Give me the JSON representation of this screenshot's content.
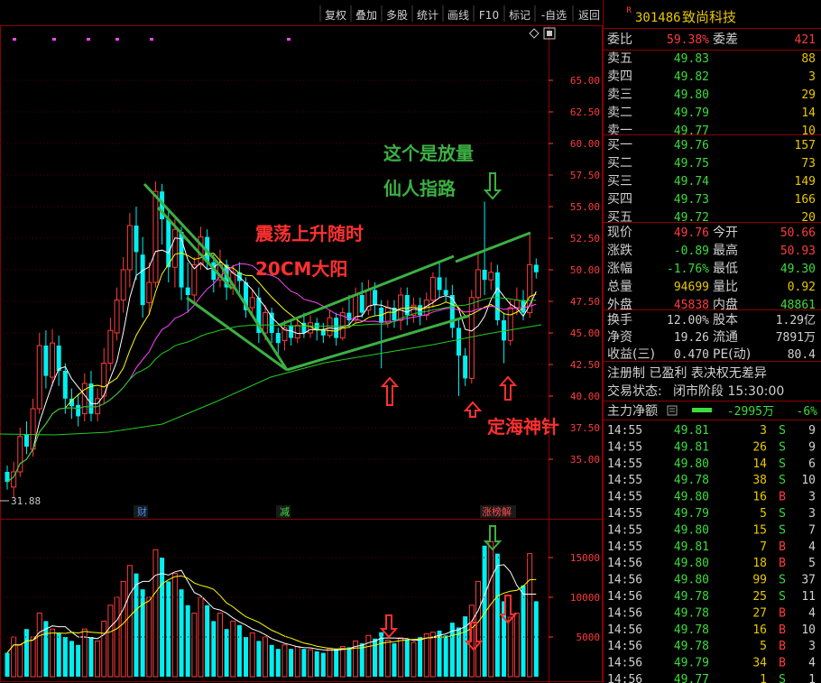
{
  "toolbar": {
    "buttons": [
      "复权",
      "叠加",
      "多股",
      "统计",
      "画线",
      "F10",
      "标记",
      "-自选",
      "返回"
    ]
  },
  "stock": {
    "badge": "R",
    "code": "301486",
    "name": "致尚科技"
  },
  "order_ratio": {
    "label1": "委比",
    "value1": "59.38%",
    "label2": "委差",
    "value2": "421"
  },
  "asks": [
    {
      "label": "卖五",
      "price": "49.83",
      "vol": "88"
    },
    {
      "label": "卖四",
      "price": "49.82",
      "vol": "3"
    },
    {
      "label": "卖三",
      "price": "49.80",
      "vol": "29"
    },
    {
      "label": "卖二",
      "price": "49.79",
      "vol": "14"
    },
    {
      "label": "卖一",
      "price": "49.77",
      "vol": "10"
    }
  ],
  "bids": [
    {
      "label": "买一",
      "price": "49.76",
      "vol": "157"
    },
    {
      "label": "买二",
      "price": "49.75",
      "vol": "73"
    },
    {
      "label": "买三",
      "price": "49.74",
      "vol": "149"
    },
    {
      "label": "买四",
      "price": "49.73",
      "vol": "166"
    },
    {
      "label": "买五",
      "price": "49.72",
      "vol": "20"
    }
  ],
  "quote": [
    {
      "l1": "现价",
      "v1": "49.76",
      "c1": "#ff3c3c",
      "l2": "今开",
      "v2": "50.66",
      "c2": "#ff3c3c"
    },
    {
      "l1": "涨跌",
      "v1": "-0.89",
      "c1": "#3cdc3c",
      "l2": "最高",
      "v2": "50.93",
      "c2": "#ff3c3c"
    },
    {
      "l1": "涨幅",
      "v1": "-1.76%",
      "c1": "#3cdc3c",
      "l2": "最低",
      "v2": "49.30",
      "c2": "#3cdc3c"
    },
    {
      "l1": "总量",
      "v1": "94699",
      "c1": "#e8c800",
      "l2": "量比",
      "v2": "0.92",
      "c2": "#e8c800"
    },
    {
      "l1": "外盘",
      "v1": "45838",
      "c1": "#ff3c3c",
      "l2": "内盘",
      "v2": "48861",
      "c2": "#3cdc3c"
    }
  ],
  "stats": [
    {
      "l1": "换手",
      "v1": "12.00%",
      "l2": "股本",
      "v2": "1.29亿"
    },
    {
      "l1": "净资",
      "v1": "19.26",
      "l2": "流通",
      "v2": "7891万"
    },
    {
      "l1": "收益(三)",
      "v1": "0.470",
      "l2": "PE(动)",
      "v2": "80.4"
    }
  ],
  "notes": {
    "reg": "注册制 已盈利 表决权无差异",
    "status_label": "交易状态:",
    "status_value": "闭市阶段 15:30:00"
  },
  "main_flow": {
    "label": "主力净额",
    "value": "-2995万",
    "pct": "-6%"
  },
  "ticks": [
    [
      "14:55",
      "49.81",
      "3",
      "S",
      "9"
    ],
    [
      "14:55",
      "49.81",
      "26",
      "S",
      "9"
    ],
    [
      "14:55",
      "49.80",
      "14",
      "S",
      "6"
    ],
    [
      "14:55",
      "49.78",
      "38",
      "S",
      "10"
    ],
    [
      "14:55",
      "49.80",
      "16",
      "B",
      "3"
    ],
    [
      "14:55",
      "49.79",
      "5",
      "S",
      "3"
    ],
    [
      "14:55",
      "49.80",
      "15",
      "S",
      "7"
    ],
    [
      "14:55",
      "49.81",
      "7",
      "B",
      "4"
    ],
    [
      "14:56",
      "49.80",
      "18",
      "B",
      "5"
    ],
    [
      "14:56",
      "49.80",
      "99",
      "S",
      "37"
    ],
    [
      "14:56",
      "49.78",
      "25",
      "S",
      "11"
    ],
    [
      "14:56",
      "49.78",
      "27",
      "B",
      "4"
    ],
    [
      "14:56",
      "49.78",
      "16",
      "B",
      "10"
    ],
    [
      "14:56",
      "49.78",
      "5",
      "B",
      "3"
    ],
    [
      "14:56",
      "49.79",
      "34",
      "B",
      "4"
    ],
    [
      "14:56",
      "49.77",
      "1",
      "S",
      "1"
    ]
  ],
  "annotations": {
    "left_title_1": "震荡上升随时",
    "left_title_2": "20CM大阳",
    "right_title_1": "这个是放量",
    "right_title_2": "仙人指路",
    "pin_label": "定海神针",
    "low_value": "31.88"
  },
  "event_markers": [
    "财",
    "减",
    "涨榜解"
  ],
  "chart_data": {
    "type": "candlestick",
    "y_range_price": [
      33.0,
      66.5
    ],
    "price_ticks": [
      "65.00",
      "62.50",
      "60.00",
      "57.50",
      "55.00",
      "52.50",
      "50.00",
      "47.50",
      "45.00",
      "42.50",
      "40.00",
      "37.50",
      "35.00"
    ],
    "volume_ticks": [
      "15000",
      "10000",
      "5000"
    ],
    "volume_range": [
      0,
      17500
    ],
    "candles": [
      {
        "o": 34,
        "c": 33.2,
        "h": 34.5,
        "l": 32.6
      },
      {
        "o": 32.8,
        "c": 34,
        "h": 34.8,
        "l": 31.9
      },
      {
        "o": 34,
        "c": 36.8,
        "h": 37.5,
        "l": 33.6
      },
      {
        "o": 37,
        "c": 36,
        "h": 38,
        "l": 35.4
      },
      {
        "o": 35.8,
        "c": 39,
        "h": 39.8,
        "l": 35.2
      },
      {
        "o": 39,
        "c": 44,
        "h": 45,
        "l": 38.6
      },
      {
        "o": 44,
        "c": 41.6,
        "h": 45.2,
        "l": 40.6
      },
      {
        "o": 41.5,
        "c": 44.2,
        "h": 45.3,
        "l": 40.8
      },
      {
        "o": 44,
        "c": 42,
        "h": 44.8,
        "l": 40.8
      },
      {
        "o": 42,
        "c": 39.8,
        "h": 42.6,
        "l": 38.6
      },
      {
        "o": 39.8,
        "c": 39.2,
        "h": 40.6,
        "l": 38.2
      },
      {
        "o": 39.3,
        "c": 38.4,
        "h": 40.2,
        "l": 37.6
      },
      {
        "o": 38.6,
        "c": 41,
        "h": 41.8,
        "l": 38
      },
      {
        "o": 41,
        "c": 38.6,
        "h": 42,
        "l": 38
      },
      {
        "o": 38.6,
        "c": 39.8,
        "h": 40.6,
        "l": 38
      },
      {
        "o": 40,
        "c": 42.6,
        "h": 43.8,
        "l": 39.4
      },
      {
        "o": 42.6,
        "c": 45.2,
        "h": 46.2,
        "l": 42
      },
      {
        "o": 45,
        "c": 47.6,
        "h": 48.6,
        "l": 44.4
      },
      {
        "o": 47.6,
        "c": 50,
        "h": 51,
        "l": 46.6
      },
      {
        "o": 50,
        "c": 53.5,
        "h": 54.5,
        "l": 48.6
      },
      {
        "o": 53.5,
        "c": 51.4,
        "h": 55,
        "l": 49.2
      },
      {
        "o": 51.2,
        "c": 47.2,
        "h": 52.6,
        "l": 46.2
      },
      {
        "o": 47.4,
        "c": 49,
        "h": 50.6,
        "l": 46.4
      },
      {
        "o": 49,
        "c": 56.2,
        "h": 57,
        "l": 48.6
      },
      {
        "o": 56.2,
        "c": 54,
        "h": 56.8,
        "l": 52
      },
      {
        "o": 54,
        "c": 50.2,
        "h": 54.8,
        "l": 49
      },
      {
        "o": 50.2,
        "c": 53.2,
        "h": 54,
        "l": 48.6
      },
      {
        "o": 53,
        "c": 48.6,
        "h": 53.4,
        "l": 47.6
      },
      {
        "o": 48.6,
        "c": 48,
        "h": 50.6,
        "l": 46.6
      },
      {
        "o": 48,
        "c": 50.4,
        "h": 51,
        "l": 47.2
      },
      {
        "o": 50.4,
        "c": 52.6,
        "h": 53.4,
        "l": 50
      },
      {
        "o": 52.6,
        "c": 50.6,
        "h": 53.2,
        "l": 50
      },
      {
        "o": 50.6,
        "c": 49.2,
        "h": 51.2,
        "l": 48.2
      },
      {
        "o": 49.2,
        "c": 50.4,
        "h": 51.6,
        "l": 48.6
      },
      {
        "o": 50.4,
        "c": 48.6,
        "h": 50.8,
        "l": 47.6
      },
      {
        "o": 48.6,
        "c": 49.8,
        "h": 50.4,
        "l": 48
      },
      {
        "o": 49.8,
        "c": 49.1,
        "h": 50.6,
        "l": 48.2
      },
      {
        "o": 49,
        "c": 46.8,
        "h": 49.4,
        "l": 46.2
      },
      {
        "o": 47,
        "c": 47.8,
        "h": 48.4,
        "l": 46.2
      },
      {
        "o": 47.8,
        "c": 45,
        "h": 48.6,
        "l": 44.2
      },
      {
        "o": 45,
        "c": 46.6,
        "h": 47.2,
        "l": 44.4
      },
      {
        "o": 46.6,
        "c": 45,
        "h": 47,
        "l": 44.2
      },
      {
        "o": 45,
        "c": 44.2,
        "h": 45.4,
        "l": 43.2
      },
      {
        "o": 44.4,
        "c": 45.4,
        "h": 46,
        "l": 43.6
      },
      {
        "o": 45.6,
        "c": 44.6,
        "h": 46,
        "l": 44
      },
      {
        "o": 44.6,
        "c": 45.6,
        "h": 46.2,
        "l": 44.2
      },
      {
        "o": 45.8,
        "c": 45,
        "h": 46.6,
        "l": 44.6
      },
      {
        "o": 45,
        "c": 45.8,
        "h": 46.4,
        "l": 44.6
      },
      {
        "o": 45.8,
        "c": 45.2,
        "h": 46.2,
        "l": 44.4
      },
      {
        "o": 45.2,
        "c": 44.8,
        "h": 45.8,
        "l": 44.2
      },
      {
        "o": 44.8,
        "c": 46.2,
        "h": 46.8,
        "l": 44.6
      },
      {
        "o": 46.2,
        "c": 44.6,
        "h": 46.6,
        "l": 44
      },
      {
        "o": 44.6,
        "c": 46.6,
        "h": 47,
        "l": 44.4
      },
      {
        "o": 46.6,
        "c": 46,
        "h": 48,
        "l": 45.6
      },
      {
        "o": 46,
        "c": 48,
        "h": 48.6,
        "l": 45.8
      },
      {
        "o": 48,
        "c": 46.6,
        "h": 49,
        "l": 46.2
      },
      {
        "o": 46.8,
        "c": 48.4,
        "h": 49.2,
        "l": 46.4
      },
      {
        "o": 48.4,
        "c": 47.2,
        "h": 49,
        "l": 46.4
      },
      {
        "o": 47,
        "c": 45.8,
        "h": 47.6,
        "l": 42.2
      },
      {
        "o": 45.8,
        "c": 47,
        "h": 47.6,
        "l": 45.4
      },
      {
        "o": 47,
        "c": 46,
        "h": 47.6,
        "l": 45.4
      },
      {
        "o": 46,
        "c": 48,
        "h": 48.6,
        "l": 45.2
      },
      {
        "o": 48,
        "c": 46.4,
        "h": 48.6,
        "l": 45.6
      },
      {
        "o": 46.4,
        "c": 47.2,
        "h": 47.8,
        "l": 45.8
      },
      {
        "o": 47.2,
        "c": 46.4,
        "h": 47.8,
        "l": 45.6
      },
      {
        "o": 46.4,
        "c": 47.6,
        "h": 48.2,
        "l": 46
      },
      {
        "o": 47.6,
        "c": 49.4,
        "h": 49.8,
        "l": 47
      },
      {
        "o": 49.4,
        "c": 48.4,
        "h": 50.6,
        "l": 47.8
      },
      {
        "o": 48.4,
        "c": 48,
        "h": 49.4,
        "l": 47.4
      },
      {
        "o": 48,
        "c": 45.4,
        "h": 48.8,
        "l": 44.6
      },
      {
        "o": 45.4,
        "c": 43.2,
        "h": 46.2,
        "l": 40
      },
      {
        "o": 43.2,
        "c": 41.4,
        "h": 43.8,
        "l": 40.8
      },
      {
        "o": 41.4,
        "c": 47.8,
        "h": 48.4,
        "l": 41
      },
      {
        "o": 47.8,
        "c": 50,
        "h": 51.4,
        "l": 47
      },
      {
        "o": 50,
        "c": 49.2,
        "h": 55.4,
        "l": 48
      },
      {
        "o": 49.2,
        "c": 49.8,
        "h": 50.6,
        "l": 48.4
      },
      {
        "o": 49.8,
        "c": 46,
        "h": 50.4,
        "l": 45.6
      },
      {
        "o": 46,
        "c": 44.4,
        "h": 46.6,
        "l": 42.6
      },
      {
        "o": 44.4,
        "c": 47,
        "h": 47.6,
        "l": 44
      },
      {
        "o": 47,
        "c": 47.6,
        "h": 48.6,
        "l": 46.4
      },
      {
        "o": 47.6,
        "c": 46.6,
        "h": 48.4,
        "l": 46
      },
      {
        "o": 46.6,
        "c": 50.4,
        "h": 52.8,
        "l": 46.2
      },
      {
        "o": 50.4,
        "c": 49.8,
        "h": 50.9,
        "l": 49.3
      }
    ],
    "volumes": [
      3000,
      5000,
      4000,
      6000,
      5000,
      8000,
      7000,
      6000,
      5500,
      5000,
      4500,
      4000,
      6000,
      5000,
      4500,
      7000,
      9000,
      10000,
      12000,
      14000,
      13000,
      11000,
      10000,
      16000,
      15000,
      12000,
      13000,
      11000,
      9000,
      8000,
      10000,
      9000,
      7000,
      8000,
      6000,
      7000,
      6500,
      5000,
      5500,
      4500,
      5000,
      4000,
      3500,
      4000,
      3500,
      3800,
      3500,
      3400,
      3200,
      3000,
      3600,
      3500,
      3800,
      3700,
      4500,
      4200,
      5200,
      4800,
      5600,
      4600,
      4200,
      4900,
      4700,
      4300,
      5000,
      5400,
      5600,
      5800,
      5200,
      6800,
      6200,
      7600,
      9000,
      12000,
      16500,
      17000,
      15500,
      9500,
      7500,
      8000,
      11500,
      15500,
      9500
    ]
  }
}
